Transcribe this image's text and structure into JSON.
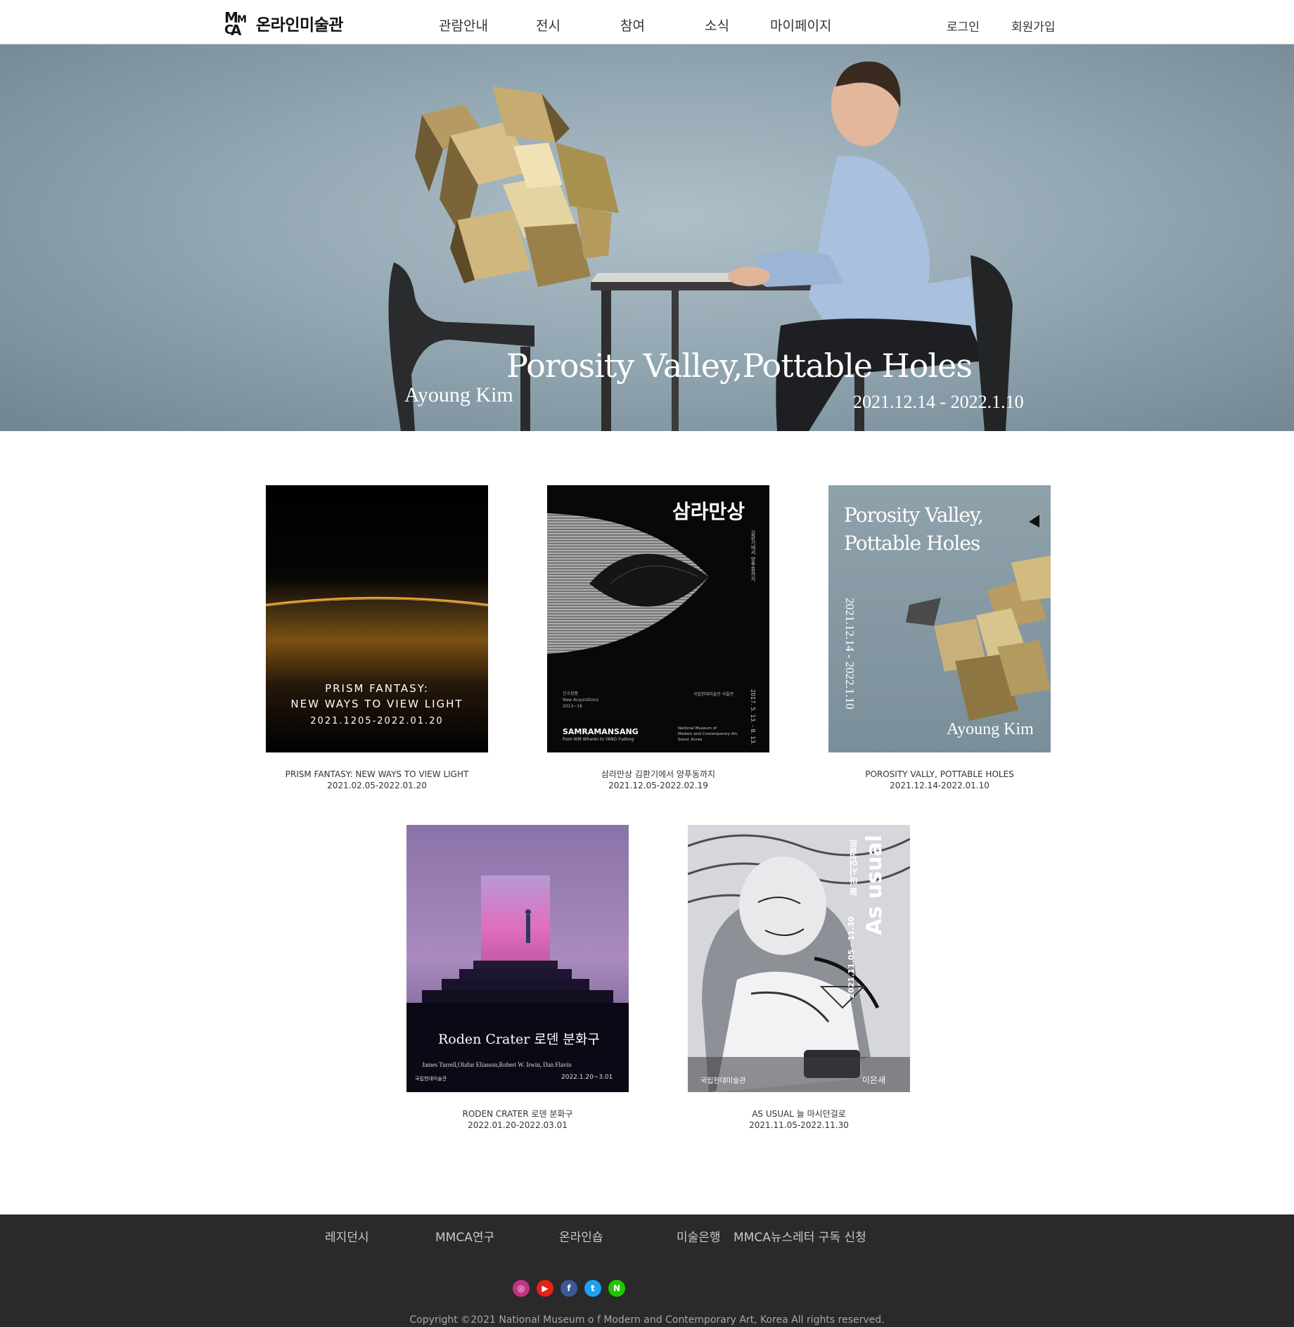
{
  "header": {
    "logo_text": "온라인미술관",
    "logo_mark": "MMCA",
    "nav": [
      "관람안내",
      "전시",
      "참여",
      "소식",
      "마이페이지"
    ],
    "auth": [
      "로그인",
      "회원가입"
    ]
  },
  "hero": {
    "title": "Porosity Valley,Pottable Holes",
    "artist": "Ayoung Kim",
    "dates": "2021.12.14 - 2022.1.10"
  },
  "exhibitions": [
    {
      "poster_lines": [
        "PRISM FANTASY:",
        "NEW WAYS TO VIEW LIGHT",
        "2021.1205-2022.01.20"
      ],
      "title": "PRISM FANTASY: NEW WAYS TO VIEW LIGHT",
      "dates": "2021.02.05-2022.01.20"
    },
    {
      "poster_title": "삼라만상",
      "poster_vertical": "김환기에서 양푸동까지",
      "poster_label": "SAMRAMANSANG",
      "poster_sub": "from KIM Whanki to YANG Fudong",
      "poster_small": [
        "신소장품",
        "New Acquisitions",
        "2013~16"
      ],
      "poster_museum_kr": "국립현대미술관 서울관",
      "poster_museum_en": [
        "National Museum of",
        "Modern and Contemporary Art,",
        "Seoul, Korea"
      ],
      "poster_date": "2017. 5. 13. - 8. 13.",
      "title": "삼라만상 김환기에서 양푸동까지",
      "dates": "2021.12.05-2022.02.19"
    },
    {
      "poster_title": [
        "Porosity Valley,",
        "Pottable Holes"
      ],
      "poster_dates": "2021.12.14 - 2022.1.10",
      "poster_artist": "Ayoung Kim",
      "title": "POROSITY VALLY, POTTABLE HOLES",
      "dates": "2021.12.14-2022.01.10"
    },
    {
      "poster_title": "Roden Crater 로덴 분화구",
      "poster_artists": "James Turrell,Olafur Eliasson,Robert W. Irwin, Dan Flavin",
      "poster_museum": "국립현대미술관",
      "poster_dates": "2022.1.20~3.01",
      "title": "RODEN CRATER 로덴 분화구",
      "dates": "2022.01.20-2022.03.01"
    },
    {
      "poster_title": "As usual",
      "poster_subtitle": "늘 마시던걸로",
      "poster_dates": "2021.11.05 - 11.30",
      "poster_museum": "국립현대미술관",
      "poster_artist": "이은새",
      "title": "AS USUAL 늘 마시던걸로",
      "dates": "2021.11.05-2022.11.30"
    }
  ],
  "footer": {
    "links": [
      "레지던시",
      "MMCA연구",
      "온라인숍",
      "미술은행",
      "MMCA뉴스레터 구독 신청"
    ],
    "social": [
      {
        "name": "instagram-icon",
        "glyph": "◎",
        "color": "#c13584"
      },
      {
        "name": "youtube-icon",
        "glyph": "▶",
        "color": "#e62117"
      },
      {
        "name": "facebook-icon",
        "glyph": "f",
        "color": "#3b5998"
      },
      {
        "name": "twitter-icon",
        "glyph": "t",
        "color": "#1da1f2"
      },
      {
        "name": "naver-icon",
        "glyph": "N",
        "color": "#1ec800"
      }
    ],
    "copyright": "Copyright ©2021 National Museum o f Modern and Contemporary Art, Korea All rights reserved."
  }
}
